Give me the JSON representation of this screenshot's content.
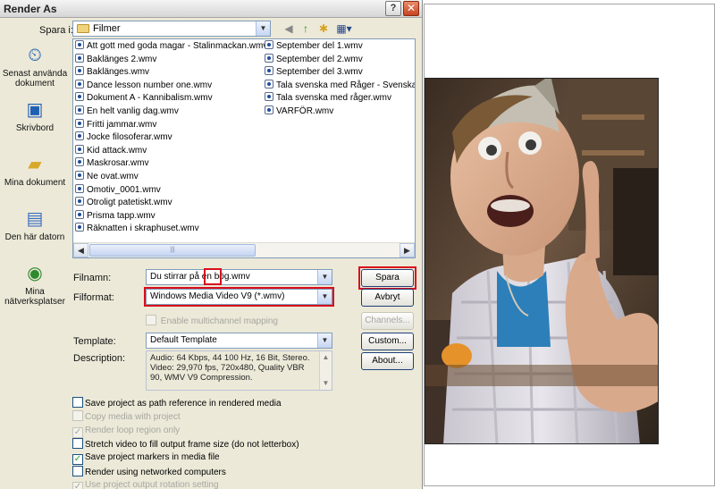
{
  "dialog": {
    "title": "Render As",
    "help_glyph": "?",
    "close_glyph": "✕"
  },
  "lookin": {
    "label": "Spara i:",
    "folder": "Filmer"
  },
  "places": [
    {
      "label": "Senast använda dokument",
      "icon": "recent-documents-icon"
    },
    {
      "label": "Skrivbord",
      "icon": "desktop-icon"
    },
    {
      "label": "Mina dokument",
      "icon": "my-documents-icon"
    },
    {
      "label": "Den här datorn",
      "icon": "my-computer-icon"
    },
    {
      "label": "Mina nätverksplatser",
      "icon": "network-places-icon"
    }
  ],
  "files_col1": [
    "Att gott med goda magar - Stalinmackan.wmv",
    "Baklänges 2.wmv",
    "Baklänges.wmv",
    "Dance lesson number one.wmv",
    "Dokument A - Kannibalism.wmv",
    "En helt vanlig dag.wmv",
    "Fritti jammar.wmv",
    "Jocke filosoferar.wmv",
    "Kid attack.wmv",
    "Maskrosar.wmv",
    "Ne ovat.wmv",
    "Omotiv_0001.wmv",
    "Otroligt patetiskt.wmv",
    "Prisma tapp.wmv",
    "Räknatten i skraphuset.wmv"
  ],
  "files_col2": [
    "September del 1.wmv",
    "September del 2.wmv",
    "September del 3.wmv",
    "Tala svenska med Råger - Svenska rä",
    "Tala svenska med råger.wmv",
    "VARFÖR.wmv"
  ],
  "form": {
    "filename_label": "Filnamn:",
    "filename_value": "Du stirrar på en bög.wmv",
    "filename_highlight": "bög",
    "format_label": "Filformat:",
    "format_value": "Windows Media Video V9 (*.wmv)",
    "multichannel_label": "Enable multichannel mapping",
    "template_label": "Template:",
    "template_value": "Default Template",
    "description_label": "Description:",
    "description_text": "Audio: 64 Kbps, 44 100 Hz, 16 Bit, Stereo. Video: 29,970 fps, 720x480, Quality VBR 90, WMV V9 Compression."
  },
  "buttons": {
    "save": "Spara",
    "cancel": "Avbryt",
    "channels": "Channels...",
    "custom": "Custom...",
    "about": "About..."
  },
  "options": [
    {
      "label": "Save project as path reference in rendered media",
      "checked": false,
      "enabled": true
    },
    {
      "label": "Copy media with project",
      "checked": false,
      "enabled": false
    },
    {
      "label": "Render loop region only",
      "checked": true,
      "enabled": false
    },
    {
      "label": "Stretch video to fill output frame size (do not letterbox)",
      "checked": false,
      "enabled": true
    },
    {
      "label": "Save project markers in media file",
      "checked": true,
      "enabled": true
    },
    {
      "label": "Render using networked computers",
      "checked": false,
      "enabled": true
    },
    {
      "label": "Use project output rotation setting",
      "checked": true,
      "enabled": false
    }
  ],
  "colors": {
    "highlight_red": "#d80f1c",
    "dialog_bg": "#ece9d8",
    "input_border": "#7f9db9"
  }
}
